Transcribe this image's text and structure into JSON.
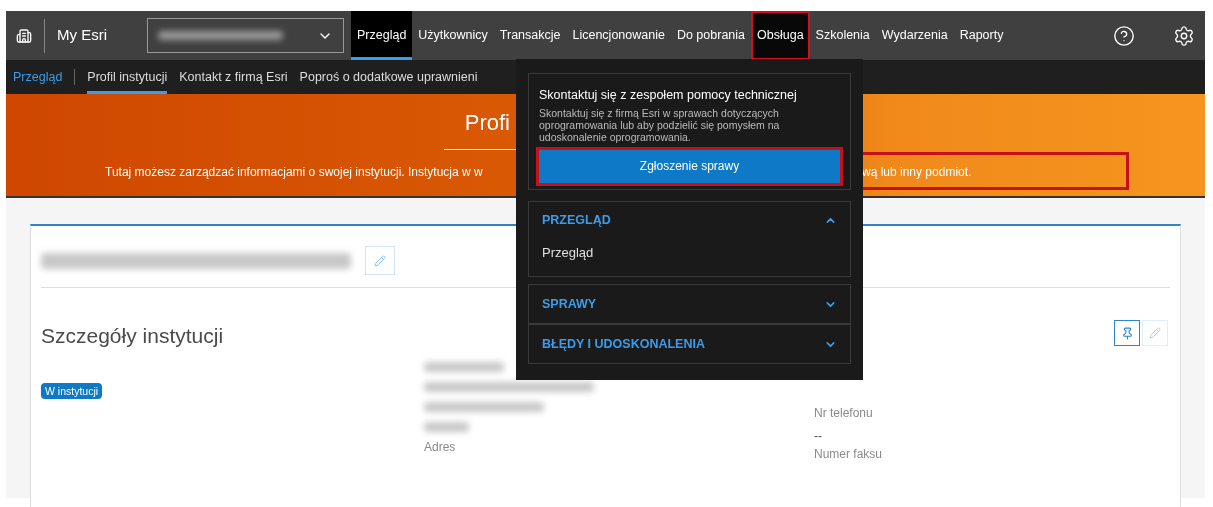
{
  "app": {
    "name": "My Esri"
  },
  "nav": [
    {
      "label": "Przegląd",
      "selected": true,
      "open": false,
      "highlighted": false
    },
    {
      "label": "Użytkownicy",
      "selected": false,
      "open": false,
      "highlighted": false
    },
    {
      "label": "Transakcje",
      "selected": false,
      "open": false,
      "highlighted": false
    },
    {
      "label": "Licencjonowanie",
      "selected": false,
      "open": false,
      "highlighted": false
    },
    {
      "label": "Do pobrania",
      "selected": false,
      "open": false,
      "highlighted": false
    },
    {
      "label": "Obsługa",
      "selected": false,
      "open": true,
      "highlighted": true
    },
    {
      "label": "Szkolenia",
      "selected": false,
      "open": false,
      "highlighted": false
    },
    {
      "label": "Wydarzenia",
      "selected": false,
      "open": false,
      "highlighted": false
    },
    {
      "label": "Raporty",
      "selected": false,
      "open": false,
      "highlighted": false
    }
  ],
  "subnav": {
    "home": "Przegląd",
    "items": [
      {
        "label": "Profil instytucji",
        "selected": true
      },
      {
        "label": "Kontakt z firmą Esri",
        "selected": false
      },
      {
        "label": "Poproś o dodatkowe uprawnieni",
        "selected": false
      }
    ]
  },
  "banner": {
    "title": "Profi",
    "text_left": "Tutaj możesz zarządzać informacjami o swojej instytucji. Instytucja w w",
    "text_right": "wą lub inny podmiot.",
    "highlighted": true
  },
  "support_menu": {
    "contact": {
      "title": "Skontaktuj się z zespołem pomocy technicznej",
      "description": "Skontaktuj się z firmą Esri w sprawach dotyczących oprogramowania lub aby podzielić się pomysłem na udoskonalenie oprogramowania.",
      "button": "Zgłoszenie sprawy",
      "button_highlighted": true
    },
    "sections": [
      {
        "title": "PRZEGLĄD",
        "expanded": true,
        "items": [
          "Przegląd"
        ]
      },
      {
        "title": "SPRAWY",
        "expanded": false
      },
      {
        "title": "BŁĘDY I UDOSKONALENIA",
        "expanded": false
      }
    ]
  },
  "details": {
    "heading": "Szczegóły instytucji",
    "badge": "W instytucji",
    "address_label": "Adres",
    "fields": [
      {
        "label": "Nr telefonu"
      },
      {
        "value": "--",
        "label": "Numer faksu"
      }
    ]
  }
}
